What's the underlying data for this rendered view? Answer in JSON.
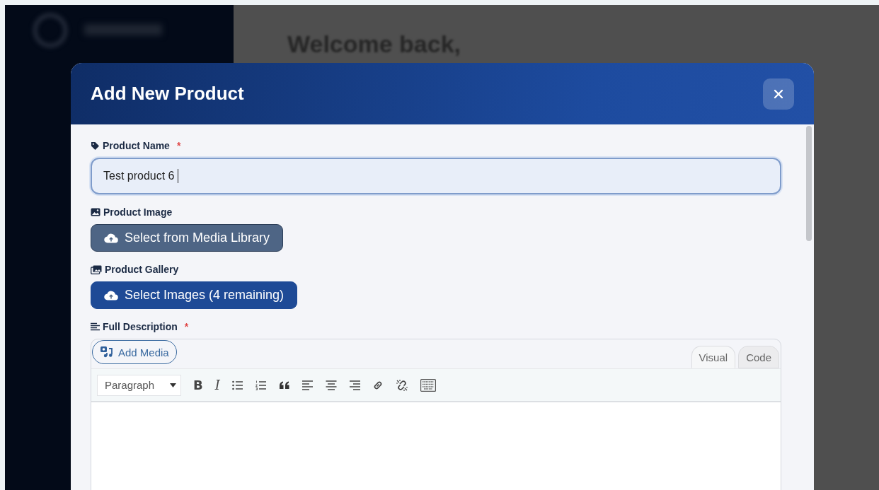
{
  "background": {
    "heading": "Welcome back,"
  },
  "modal": {
    "title": "Add New Product",
    "fields": [
      {
        "kind": "text",
        "label": "Product Name",
        "required_mark": "*",
        "value": "Test product 6"
      },
      {
        "kind": "media",
        "label": "Product Image",
        "button": "Select from Media Library"
      },
      {
        "kind": "gallery",
        "label": "Product Gallery",
        "button": "Select Images (4 remaining)"
      },
      {
        "kind": "editor",
        "label": "Full Description",
        "required_mark": "*",
        "add_media": "Add Media",
        "format": "Paragraph",
        "tabs": [
          {
            "label": "Visual",
            "selected": true
          },
          {
            "label": "Code",
            "selected": false
          }
        ],
        "toolbar": [
          {
            "kind": "text",
            "label": "B"
          },
          {
            "kind": "text-italic",
            "label": "I"
          },
          {
            "kind": "bullet-list"
          },
          {
            "kind": "numbered-list"
          },
          {
            "kind": "quote"
          },
          {
            "kind": "align-left"
          },
          {
            "kind": "align-center"
          },
          {
            "kind": "align-right"
          },
          {
            "kind": "link"
          },
          {
            "kind": "unlink"
          },
          {
            "kind": "keyboard"
          }
        ]
      }
    ]
  }
}
